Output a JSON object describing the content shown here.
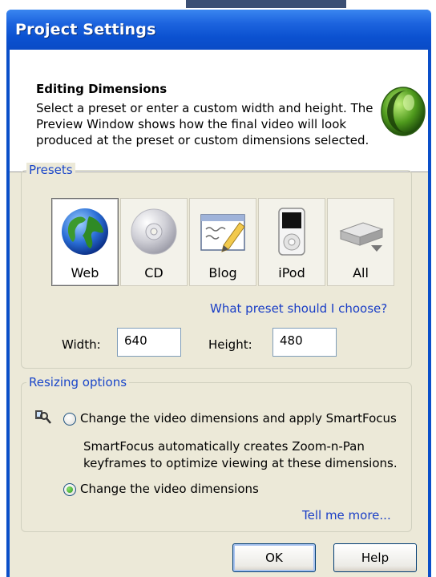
{
  "window": {
    "title": "Project Settings"
  },
  "header": {
    "title": "Editing Dimensions",
    "description": "Select a preset or enter a custom width and height. The Preview Window shows how the final video will look produced at the preset or custom dimensions selected.",
    "logo_icon": "camtasia-logo-icon"
  },
  "presets": {
    "legend": "Presets",
    "selected": "Web",
    "items": [
      {
        "label": "Web",
        "icon": "globe-icon"
      },
      {
        "label": "CD",
        "icon": "cd-disc-icon"
      },
      {
        "label": "Blog",
        "icon": "blog-pencil-icon"
      },
      {
        "label": "iPod",
        "icon": "ipod-icon"
      },
      {
        "label": "All",
        "icon": "all-presets-dropdown-icon"
      }
    ],
    "help_link": "What preset should I choose?",
    "width_label": "Width:",
    "width_value": "640",
    "height_label": "Height:",
    "height_value": "480"
  },
  "resizing": {
    "legend": "Resizing options",
    "smartfocus_label": "Change the video dimensions and apply SmartFocus",
    "smartfocus_desc": "SmartFocus automatically creates Zoom-n-Pan keyframes to optimize viewing at these dimensions.",
    "plain_label": "Change the video dimensions",
    "selected_option": "Change the video dimensions",
    "tell_more_link": "Tell me more...",
    "smartfocus_icon": "smartfocus-magnifier-icon"
  },
  "buttons": {
    "ok": "OK",
    "help": "Help"
  },
  "colors": {
    "titlebar": "#0b51d0",
    "dialog_bg": "#ece9d8",
    "link": "#1a3ec6",
    "group_legend": "#1a46c9"
  }
}
